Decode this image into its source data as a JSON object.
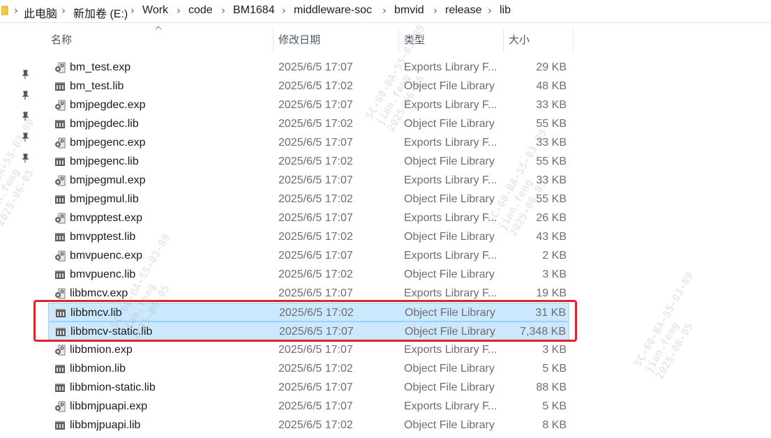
{
  "breadcrumb": [
    "此电脑",
    "新加卷 (E:)",
    "Work",
    "code",
    "BM1684",
    "middleware-soc",
    "bmvid",
    "release",
    "lib"
  ],
  "columns": {
    "name": "名称",
    "date": "修改日期",
    "type": "类型",
    "size": "大小"
  },
  "files": [
    {
      "name": "bm_test.exp",
      "date": "2025/6/5 17:07",
      "type": "Exports Library F...",
      "size": "29 KB",
      "icon": "exp-file-icon"
    },
    {
      "name": "bm_test.lib",
      "date": "2025/6/5 17:02",
      "type": "Object File Library",
      "size": "48 KB",
      "icon": "lib-file-icon"
    },
    {
      "name": "bmjpegdec.exp",
      "date": "2025/6/5 17:07",
      "type": "Exports Library F...",
      "size": "33 KB",
      "icon": "exp-file-icon"
    },
    {
      "name": "bmjpegdec.lib",
      "date": "2025/6/5 17:02",
      "type": "Object File Library",
      "size": "55 KB",
      "icon": "lib-file-icon"
    },
    {
      "name": "bmjpegenc.exp",
      "date": "2025/6/5 17:07",
      "type": "Exports Library F...",
      "size": "33 KB",
      "icon": "exp-file-icon"
    },
    {
      "name": "bmjpegenc.lib",
      "date": "2025/6/5 17:02",
      "type": "Object File Library",
      "size": "55 KB",
      "icon": "lib-file-icon"
    },
    {
      "name": "bmjpegmul.exp",
      "date": "2025/6/5 17:07",
      "type": "Exports Library F...",
      "size": "33 KB",
      "icon": "exp-file-icon"
    },
    {
      "name": "bmjpegmul.lib",
      "date": "2025/6/5 17:02",
      "type": "Object File Library",
      "size": "55 KB",
      "icon": "lib-file-icon"
    },
    {
      "name": "bmvpptest.exp",
      "date": "2025/6/5 17:07",
      "type": "Exports Library F...",
      "size": "26 KB",
      "icon": "exp-file-icon"
    },
    {
      "name": "bmvpptest.lib",
      "date": "2025/6/5 17:02",
      "type": "Object File Library",
      "size": "43 KB",
      "icon": "lib-file-icon"
    },
    {
      "name": "bmvpuenc.exp",
      "date": "2025/6/5 17:07",
      "type": "Exports Library F...",
      "size": "2 KB",
      "icon": "exp-file-icon"
    },
    {
      "name": "bmvpuenc.lib",
      "date": "2025/6/5 17:02",
      "type": "Object File Library",
      "size": "3 KB",
      "icon": "lib-file-icon"
    },
    {
      "name": "libbmcv.exp",
      "date": "2025/6/5 17:07",
      "type": "Exports Library F...",
      "size": "19 KB",
      "icon": "exp-file-icon"
    },
    {
      "name": "libbmcv.lib",
      "date": "2025/6/5 17:02",
      "type": "Object File Library",
      "size": "31 KB",
      "icon": "lib-file-icon",
      "selected": true
    },
    {
      "name": "libbmcv-static.lib",
      "date": "2025/6/5 17:07",
      "type": "Object File Library",
      "size": "7,348 KB",
      "icon": "lib-file-icon",
      "selected": true
    },
    {
      "name": "libbmion.exp",
      "date": "2025/6/5 17:07",
      "type": "Exports Library F...",
      "size": "3 KB",
      "icon": "exp-file-icon"
    },
    {
      "name": "libbmion.lib",
      "date": "2025/6/5 17:02",
      "type": "Object File Library",
      "size": "5 KB",
      "icon": "lib-file-icon"
    },
    {
      "name": "libbmion-static.lib",
      "date": "2025/6/5 17:07",
      "type": "Object File Library",
      "size": "88 KB",
      "icon": "lib-file-icon"
    },
    {
      "name": "libbmjpuapi.exp",
      "date": "2025/6/5 17:07",
      "type": "Exports Library F...",
      "size": "5 KB",
      "icon": "exp-file-icon"
    },
    {
      "name": "libbmjpuapi.lib",
      "date": "2025/6/5 17:02",
      "type": "Object File Library",
      "size": "8 KB",
      "icon": "lib-file-icon"
    }
  ],
  "watermark": {
    "lines": [
      "5C-60-BA-55-03-89",
      "jian.feng",
      "2025-06-05"
    ]
  },
  "colors": {
    "selection": "#cce8ff",
    "selection_border": "#99d1ff",
    "annotation": "#e0222b",
    "header_text": "#4b5a6a"
  }
}
